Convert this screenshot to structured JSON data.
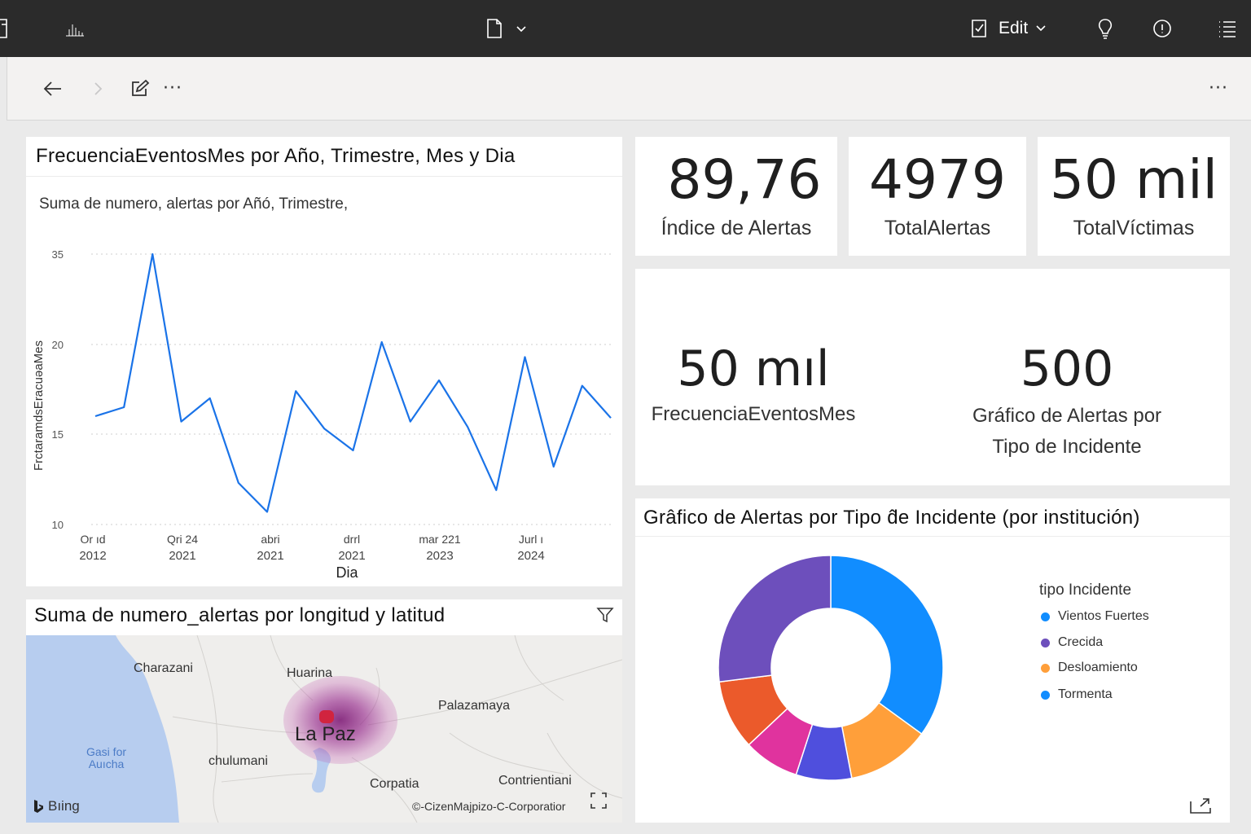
{
  "toolbar": {
    "edit_label": "Edit"
  },
  "line_chart": {
    "title": "FrecuenciaEventosMes por Año, Trimestre, Mes y Dia",
    "subtitle": "Suma de numero, alertas por Añó, Trimestre,",
    "ylabel": "FrctaramdsEracuəaMes",
    "xlabel": "Dia",
    "y_ticks": [
      "35",
      "20",
      "15",
      "10"
    ],
    "x_ticks": [
      {
        "line1": "Or ıd",
        "line2": "2012"
      },
      {
        "line1": "Qri 24",
        "line2": "2021"
      },
      {
        "line1": "abri",
        "line2": "2021"
      },
      {
        "line1": "drrl",
        "line2": "2021"
      },
      {
        "line1": "mar 221",
        "line2": "2023"
      },
      {
        "line1": "Jurl ı",
        "line2": "2024"
      }
    ],
    "color": "#1a73e8"
  },
  "chart_data": [
    {
      "type": "line",
      "title": "FrecuenciaEventosMes por Año, Trimestre, Mes y Dia",
      "subtitle": "Suma de numero, alertas por Añó, Trimestre,",
      "xlabel": "Dia",
      "ylabel": "FrctaramdsEracuəaMes",
      "y_ticks": [
        "35",
        "20",
        "15",
        "10"
      ],
      "x_tick_labels": [
        "Or ıd 2012",
        "Qri 24 2021",
        "abri 2021",
        "drrl 2021",
        "mar 221 2023",
        "Jurl ı 2024"
      ],
      "series": [
        {
          "values": [
            16.0,
            16.5,
            35.0,
            15.7,
            17.0,
            12.3,
            10.7,
            17.4,
            15.3,
            14.1,
            20.4,
            15.7,
            18.0,
            15.4,
            11.9,
            19.3,
            13.2,
            17.7,
            15.9
          ]
        }
      ],
      "grid": true
    },
    {
      "type": "pie",
      "title": "Grâfico de Alertas por Tipo d̂e Incidente (por institución)",
      "legend_title": "tipo Incidente",
      "legend_position": "right",
      "legend": [
        "Vientos Fuertes",
        "Crecida",
        "Desloamiento",
        "Tormenta"
      ],
      "slices": [
        {
          "color": "#118dff",
          "value": 35
        },
        {
          "color": "#ff9f3a",
          "value": 12
        },
        {
          "color": "#4f4fdd",
          "value": 8
        },
        {
          "color": "#e0339e",
          "value": 8
        },
        {
          "color": "#eb5a2b",
          "value": 10
        },
        {
          "color": "#6d4fbc",
          "value": 27
        }
      ]
    }
  ],
  "kpis": [
    {
      "value": "89,76",
      "label": "Índice de Alertas"
    },
    {
      "value": "4979",
      "label": "TotalAlertas"
    },
    {
      "value": "50 mil",
      "label": "TotalVíctimas"
    }
  ],
  "big_kpis": [
    {
      "value": "50 mıl",
      "label": "FrecuenciaEventosMes"
    },
    {
      "value": "500",
      "label_line1": "Gráfico de Alertas por",
      "label_line2": "Tipo de Incidente"
    }
  ],
  "donut": {
    "title": "Grâfico de Alertas por Tipo d̂e Incidente (por institución)",
    "legend_title": "tipo Incidente",
    "legend": [
      {
        "label": "Vientos Fuertes",
        "color": "#118dff"
      },
      {
        "label": "Crecida",
        "color": "#6d4fbc"
      },
      {
        "label": "Desloamiento",
        "color": "#ff9f3a"
      },
      {
        "label": "Tormenta",
        "color": "#118dff"
      }
    ]
  },
  "map": {
    "title": "Suma de numero_alertas por longitud y latitud",
    "places": {
      "charazani": "Charazani",
      "huarina": "Huarina",
      "palazamaya": "Palazamaya",
      "lapaz": "La Paz",
      "chulumani": "chulumani",
      "corpatia": "Corpatia",
      "contrientiani": "Contrientiani",
      "water1": "Gasi for",
      "water2": "Auıcha"
    },
    "bing": "Bıing",
    "copyright": "©-CizenMajpizo-C-Corporatior"
  }
}
